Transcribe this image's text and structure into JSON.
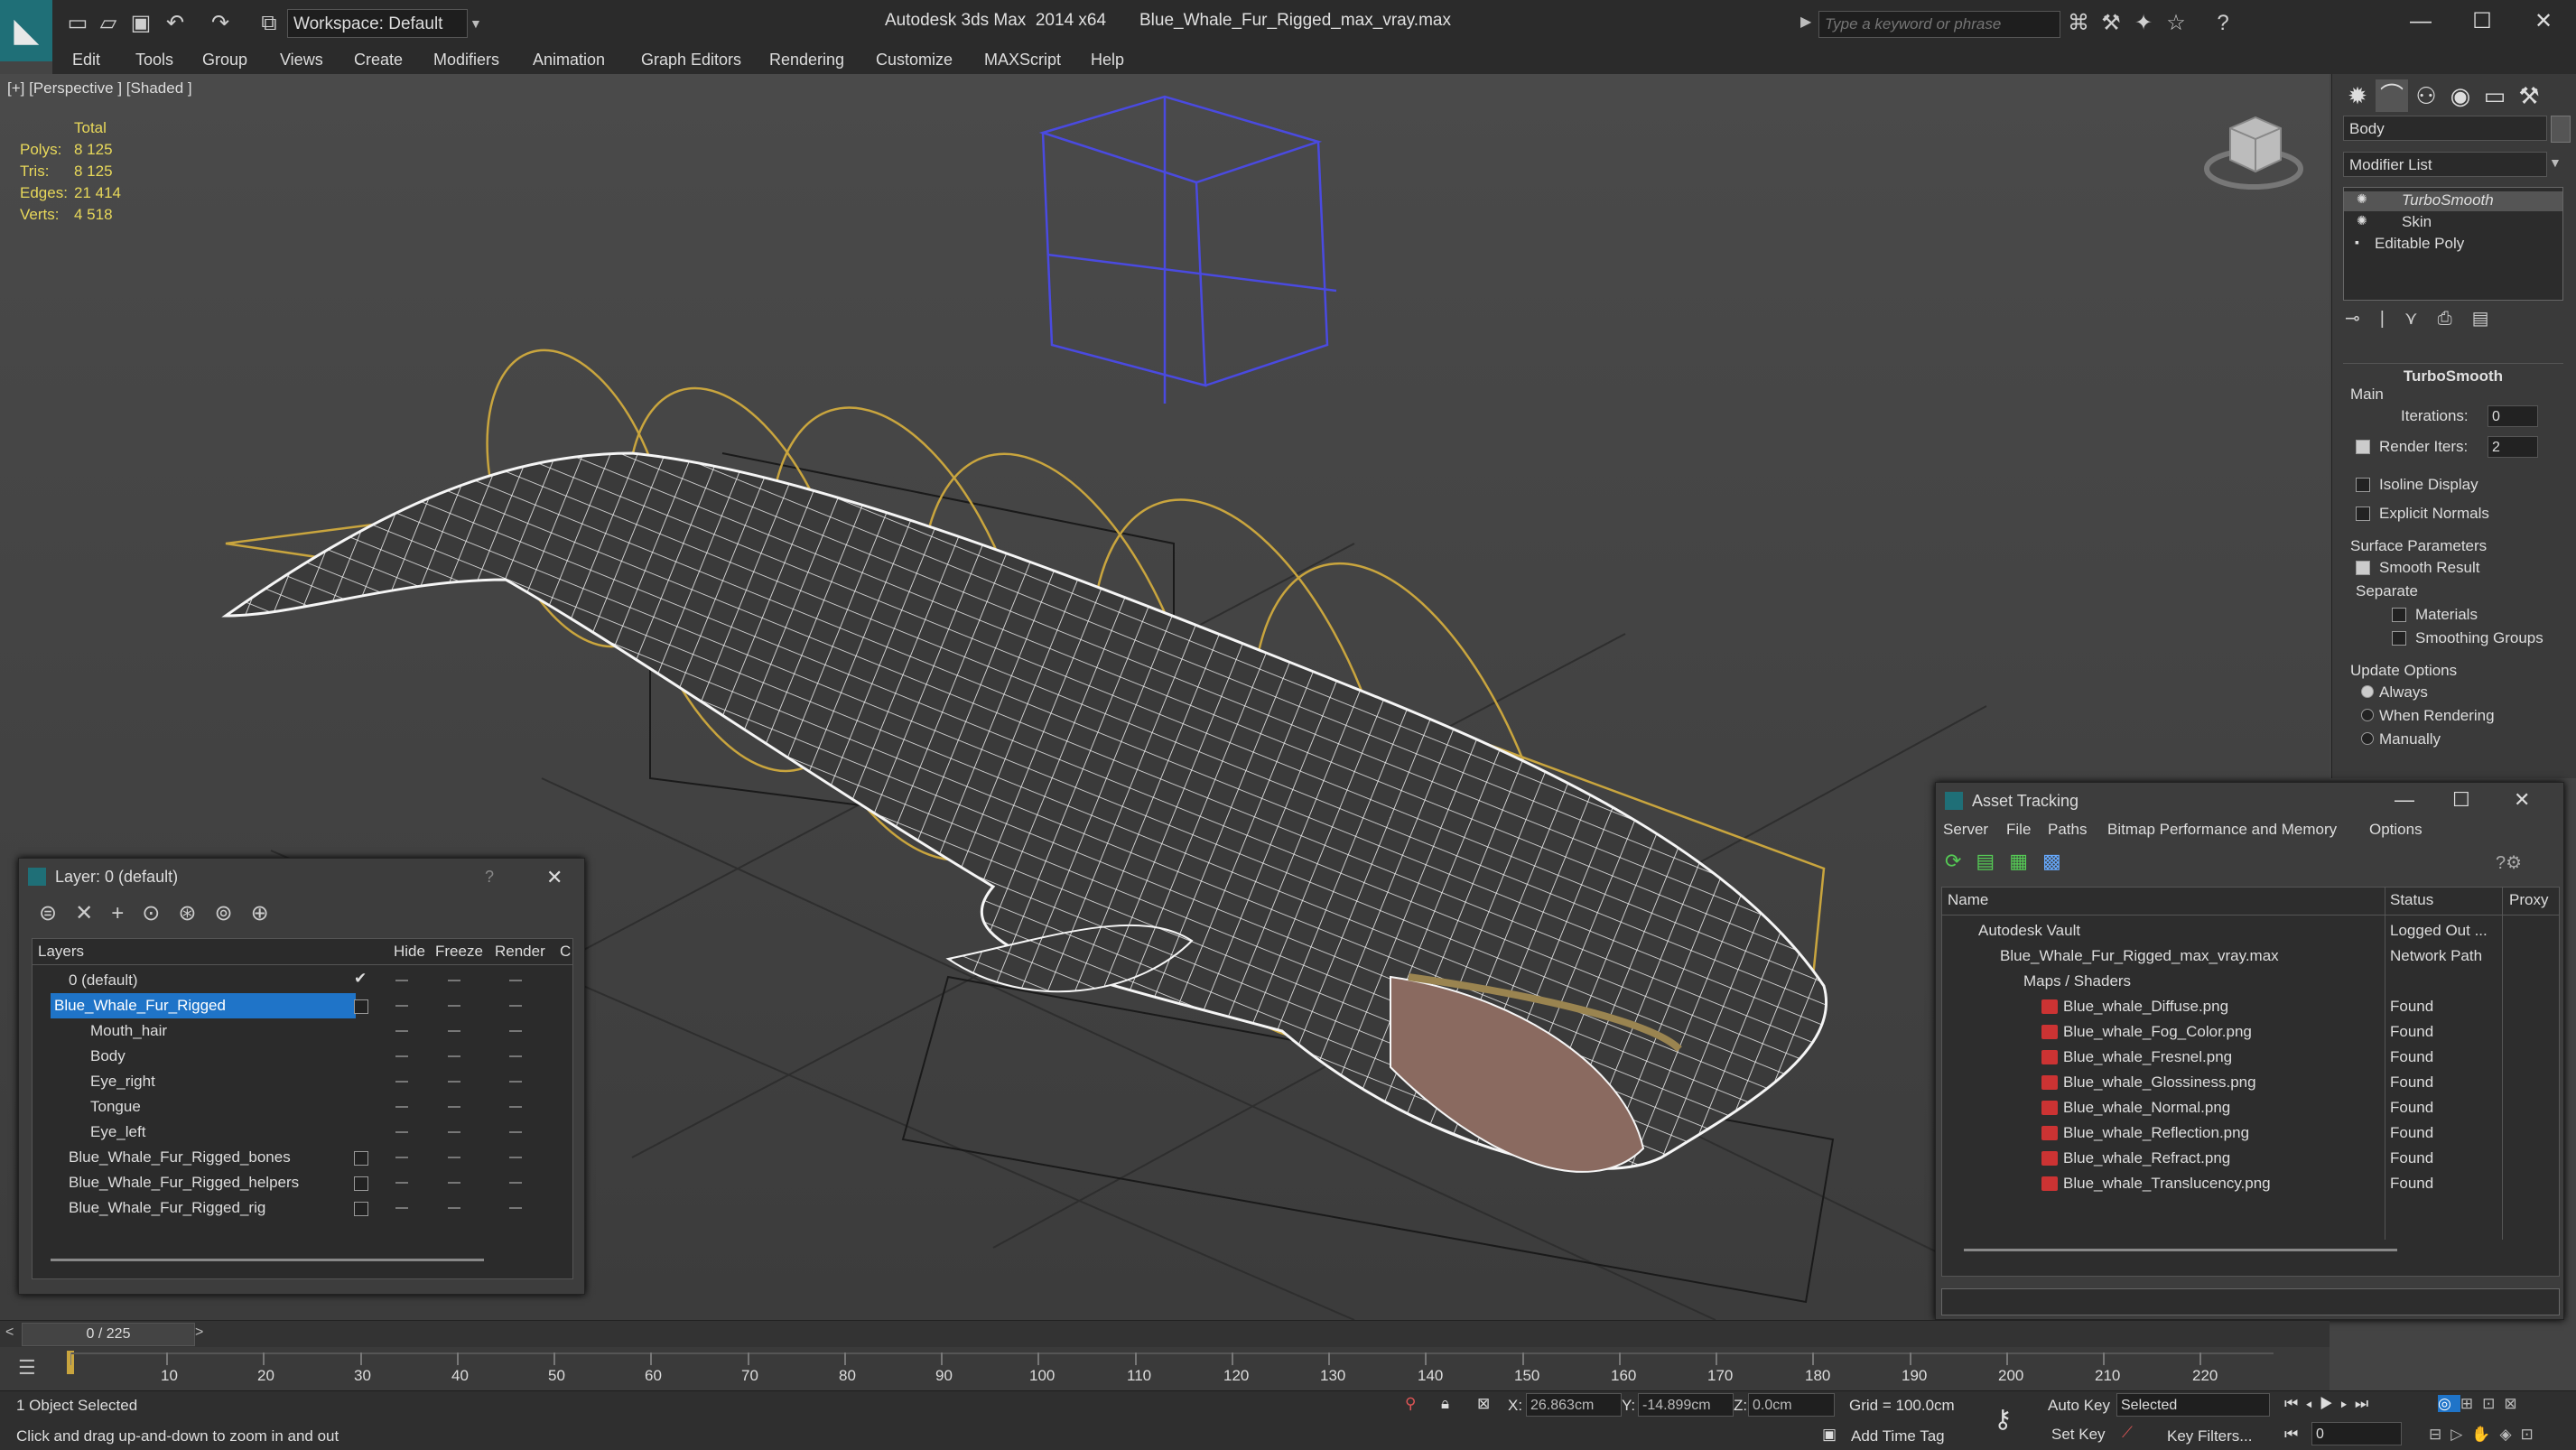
{
  "app": {
    "title": "Autodesk 3ds Max  2014 x64       Blue_Whale_Fur_Rigged_max_vray.max",
    "workspace": "Workspace: Default",
    "search_placeholder": "Type a keyword or phrase"
  },
  "menu": [
    "Edit",
    "Tools",
    "Group",
    "Views",
    "Create",
    "Modifiers",
    "Animation",
    "Graph Editors",
    "Rendering",
    "Customize",
    "MAXScript",
    "Help"
  ],
  "viewport": {
    "label": "[+] [Perspective ] [Shaded ]",
    "stats_header": "Total",
    "stats": [
      {
        "label": "Polys:",
        "value": "8 125"
      },
      {
        "label": "Tris:",
        "value": "8 125"
      },
      {
        "label": "Edges:",
        "value": "21 414"
      },
      {
        "label": "Verts:",
        "value": "4 518"
      }
    ]
  },
  "command_panel": {
    "object_name": "Body",
    "modifier_list": "Modifier List",
    "stack": [
      "TurboSmooth",
      "Skin",
      "Editable Poly"
    ],
    "rollout_title": "TurboSmooth",
    "main_label": "Main",
    "iterations_label": "Iterations:",
    "iterations_value": "0",
    "render_iters_label": "Render Iters:",
    "render_iters_value": "2",
    "isoline": "Isoline Display",
    "explicit_normals": "Explicit Normals",
    "surface_params": "Surface Parameters",
    "smooth_result": "Smooth Result",
    "separate": "Separate",
    "materials": "Materials",
    "smoothing_groups": "Smoothing Groups",
    "update_options": "Update Options",
    "always": "Always",
    "when_rendering": "When Rendering",
    "manually": "Manually"
  },
  "layer_explorer": {
    "title": "Layer: 0 (default)",
    "help": "?",
    "columns": {
      "layers": "Layers",
      "hide": "Hide",
      "freeze": "Freeze",
      "render": "Render",
      "c": "C"
    },
    "rows": [
      {
        "name": "0 (default)",
        "indent": 0,
        "selected": false
      },
      {
        "name": "Blue_Whale_Fur_Rigged",
        "indent": 0,
        "selected": true
      },
      {
        "name": "Mouth_hair",
        "indent": 1,
        "selected": false
      },
      {
        "name": "Body",
        "indent": 1,
        "selected": false
      },
      {
        "name": "Eye_right",
        "indent": 1,
        "selected": false
      },
      {
        "name": "Tongue",
        "indent": 1,
        "selected": false
      },
      {
        "name": "Eye_left",
        "indent": 1,
        "selected": false
      },
      {
        "name": "Blue_Whale_Fur_Rigged_bones",
        "indent": 0,
        "selected": false
      },
      {
        "name": "Blue_Whale_Fur_Rigged_helpers",
        "indent": 0,
        "selected": false
      },
      {
        "name": "Blue_Whale_Fur_Rigged_rig",
        "indent": 0,
        "selected": false
      }
    ]
  },
  "asset_tracking": {
    "title": "Asset Tracking",
    "menu": [
      "Server",
      "File",
      "Paths",
      "Bitmap Performance and Memory",
      "Options"
    ],
    "columns": {
      "name": "Name",
      "status": "Status",
      "proxy": "Proxy"
    },
    "rows": [
      {
        "name": "Autodesk Vault",
        "status": "Logged Out ...",
        "indent": 1
      },
      {
        "name": "Blue_Whale_Fur_Rigged_max_vray.max",
        "status": "Network Path",
        "indent": 2
      },
      {
        "name": "Maps / Shaders",
        "status": "",
        "indent": 3
      },
      {
        "name": "Blue_whale_Diffuse.png",
        "status": "Found",
        "indent": 4
      },
      {
        "name": "Blue_whale_Fog_Color.png",
        "status": "Found",
        "indent": 4
      },
      {
        "name": "Blue_whale_Fresnel.png",
        "status": "Found",
        "indent": 4
      },
      {
        "name": "Blue_whale_Glossiness.png",
        "status": "Found",
        "indent": 4
      },
      {
        "name": "Blue_whale_Normal.png",
        "status": "Found",
        "indent": 4
      },
      {
        "name": "Blue_whale_Reflection.png",
        "status": "Found",
        "indent": 4
      },
      {
        "name": "Blue_whale_Refract.png",
        "status": "Found",
        "indent": 4
      },
      {
        "name": "Blue_whale_Translucency.png",
        "status": "Found",
        "indent": 4
      }
    ]
  },
  "timeline": {
    "frame": "0 / 225",
    "ticks": [
      "10",
      "20",
      "30",
      "40",
      "50",
      "60",
      "70",
      "80",
      "90",
      "100",
      "110",
      "120",
      "130",
      "140",
      "150",
      "160",
      "170",
      "180",
      "190",
      "200",
      "210",
      "220"
    ]
  },
  "status": {
    "selection": "1 Object Selected",
    "prompt": "Click and drag up-and-down to zoom in and out",
    "x_label": "X:",
    "x_value": "26.863cm",
    "y_label": "Y:",
    "y_value": "-14.899cm",
    "z_label": "Z:",
    "z_value": "0.0cm",
    "grid": "Grid = 100.0cm",
    "add_time_tag": "Add Time Tag",
    "auto_key": "Auto Key",
    "set_key": "Set Key",
    "selected": "Selected",
    "key_filters": "Key Filters...",
    "frame_value": "0"
  },
  "colors": {
    "accent": "#1f74c8",
    "wire": "#ffffff",
    "bone": "#d4b04a",
    "helper": "#4a4ae0",
    "stats": "#e8d85a"
  }
}
